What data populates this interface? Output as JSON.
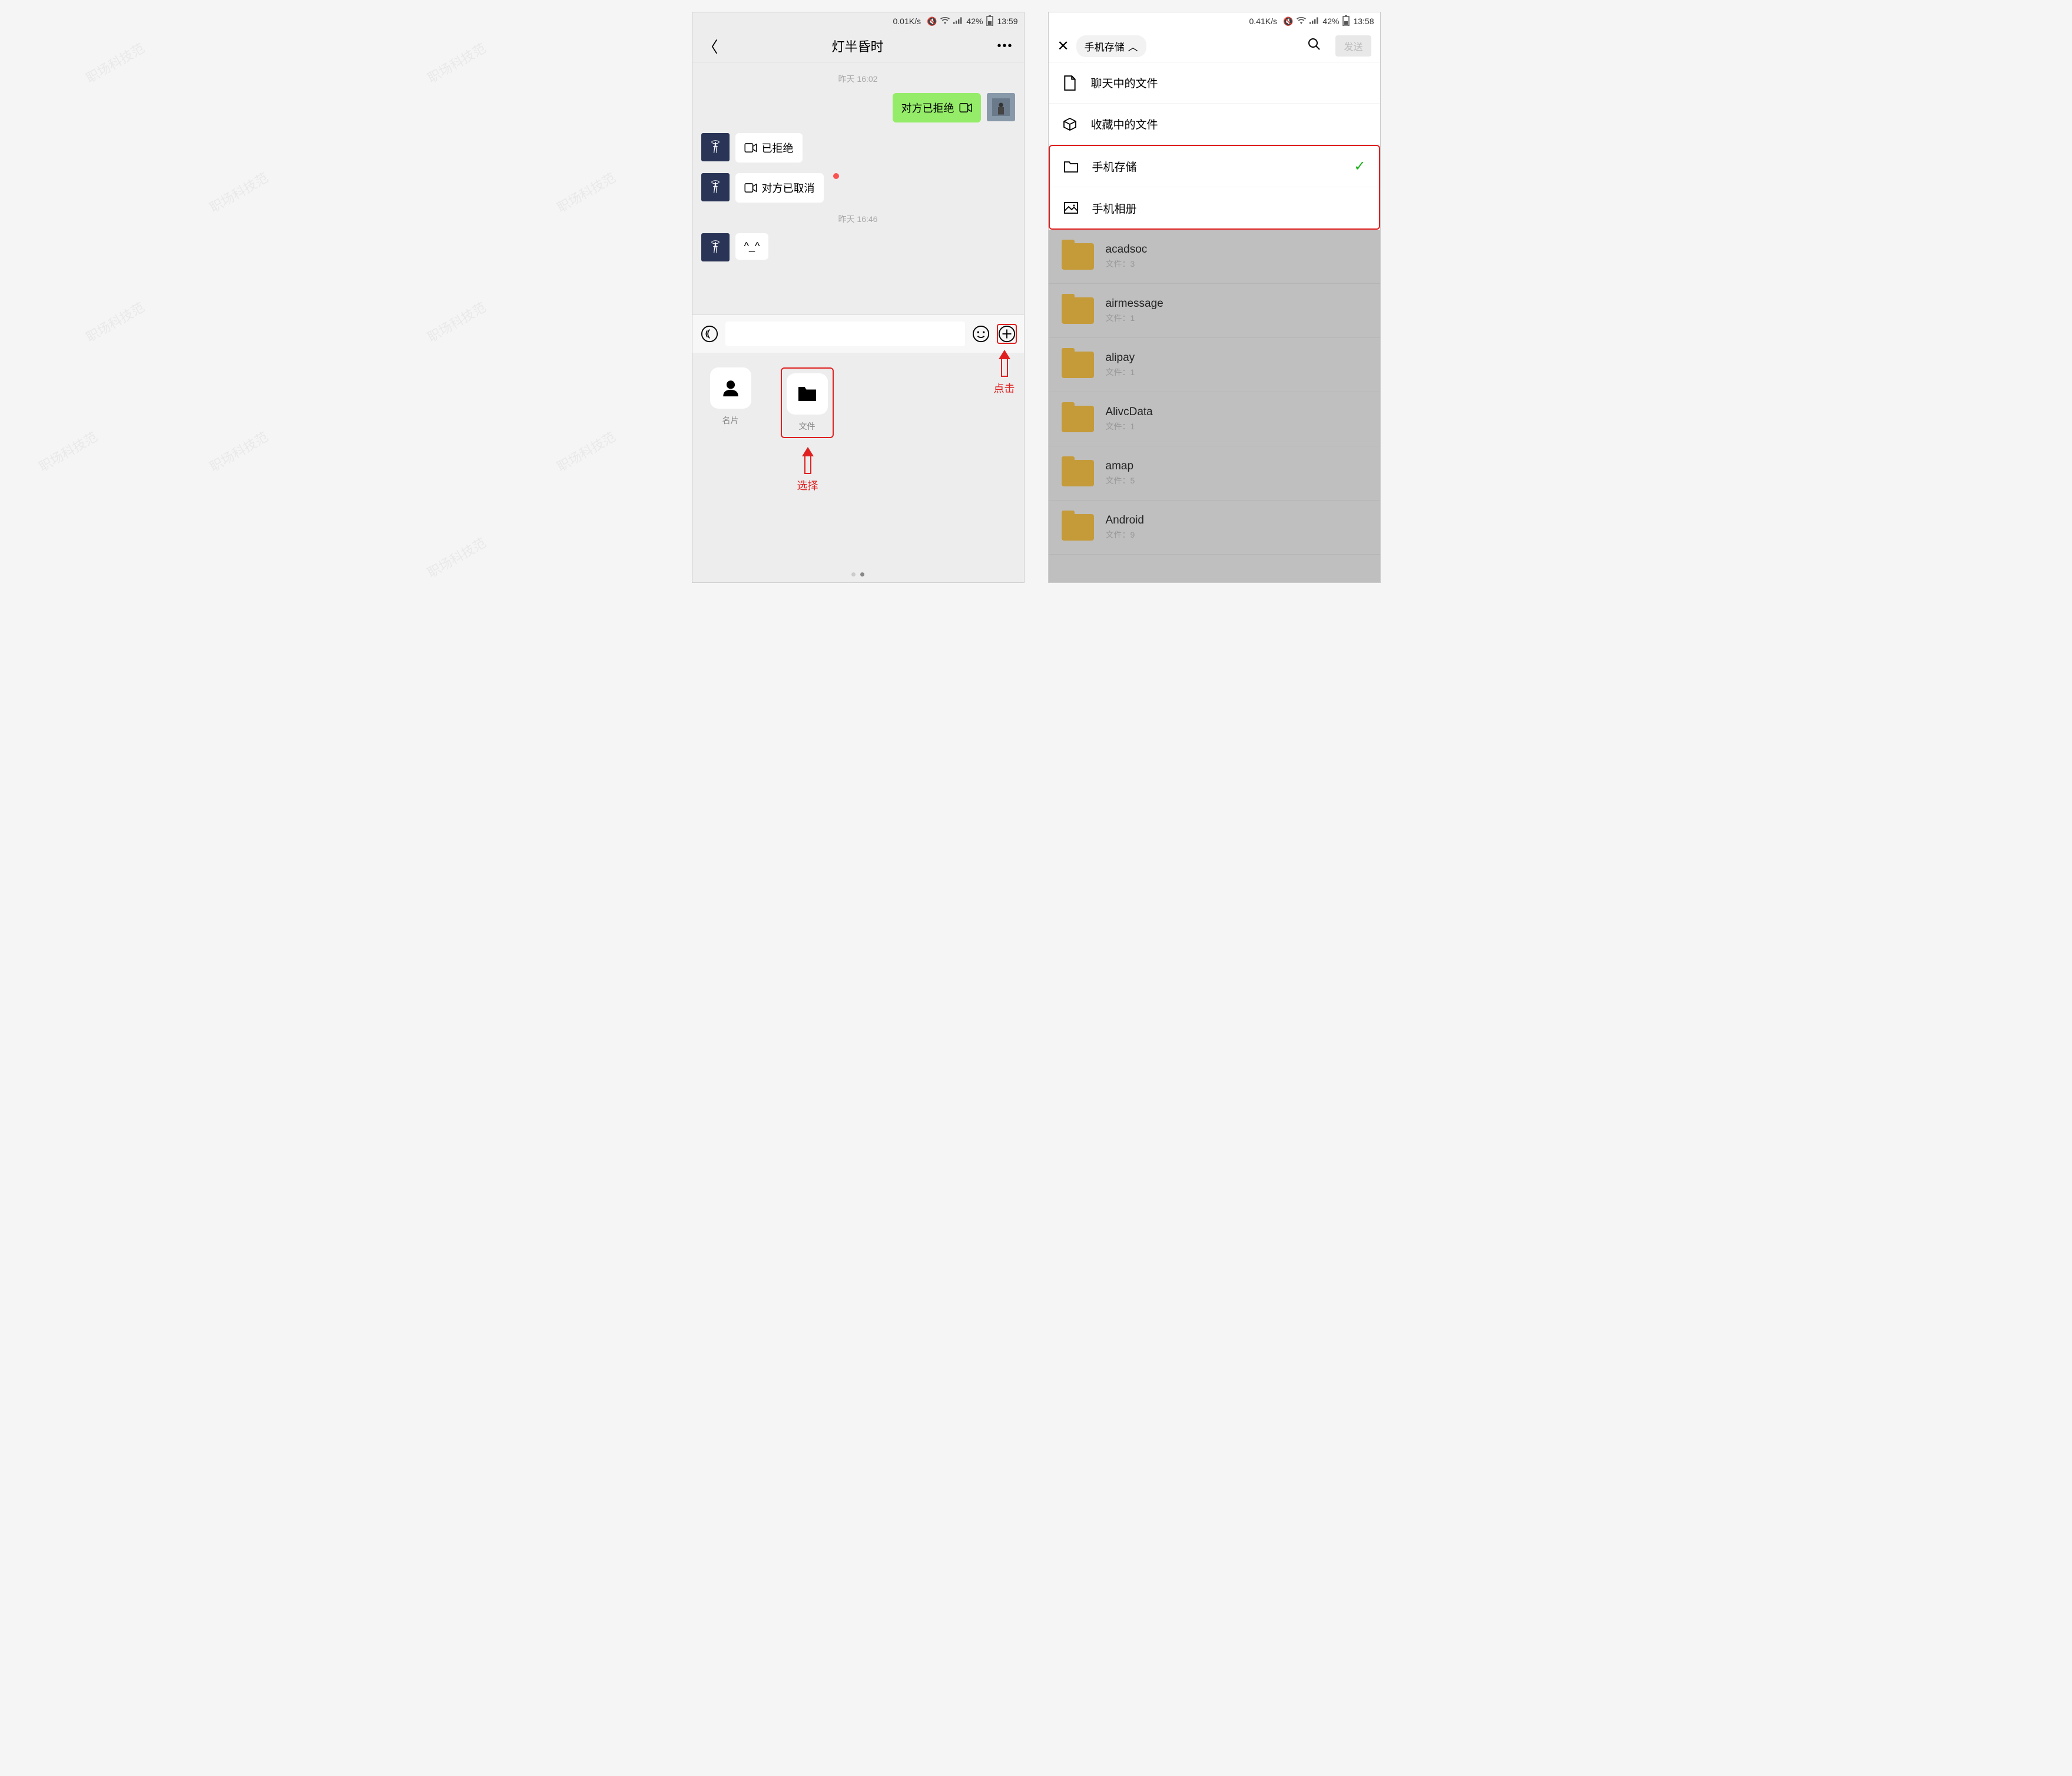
{
  "watermark": "职场科技范",
  "left": {
    "status": {
      "speed": "0.01K/s",
      "battery": "42%",
      "time": "13:59"
    },
    "title": "灯半昏时",
    "ts1": "昨天 16:02",
    "ts2": "昨天 16:46",
    "msg_out": "对方已拒绝",
    "msg_in1": "已拒绝",
    "msg_in2": "对方已取消",
    "msg_face": "^_^",
    "attach": {
      "card": "名片",
      "file": "文件"
    },
    "annot_click": "点击",
    "annot_select": "选择"
  },
  "right": {
    "status": {
      "speed": "0.41K/s",
      "battery": "42%",
      "time": "13:58"
    },
    "breadcrumb": "手机存储",
    "send": "发送",
    "sources": {
      "chat": "聊天中的文件",
      "fav": "收藏中的文件",
      "storage": "手机存储",
      "album": "手机相册"
    },
    "file_prefix": "文件：",
    "folders": [
      {
        "name": "acadsoc",
        "count": "3"
      },
      {
        "name": "airmessage",
        "count": "1"
      },
      {
        "name": "alipay",
        "count": "1"
      },
      {
        "name": "AlivcData",
        "count": "1"
      },
      {
        "name": "amap",
        "count": "5"
      },
      {
        "name": "Android",
        "count": "9"
      }
    ]
  }
}
